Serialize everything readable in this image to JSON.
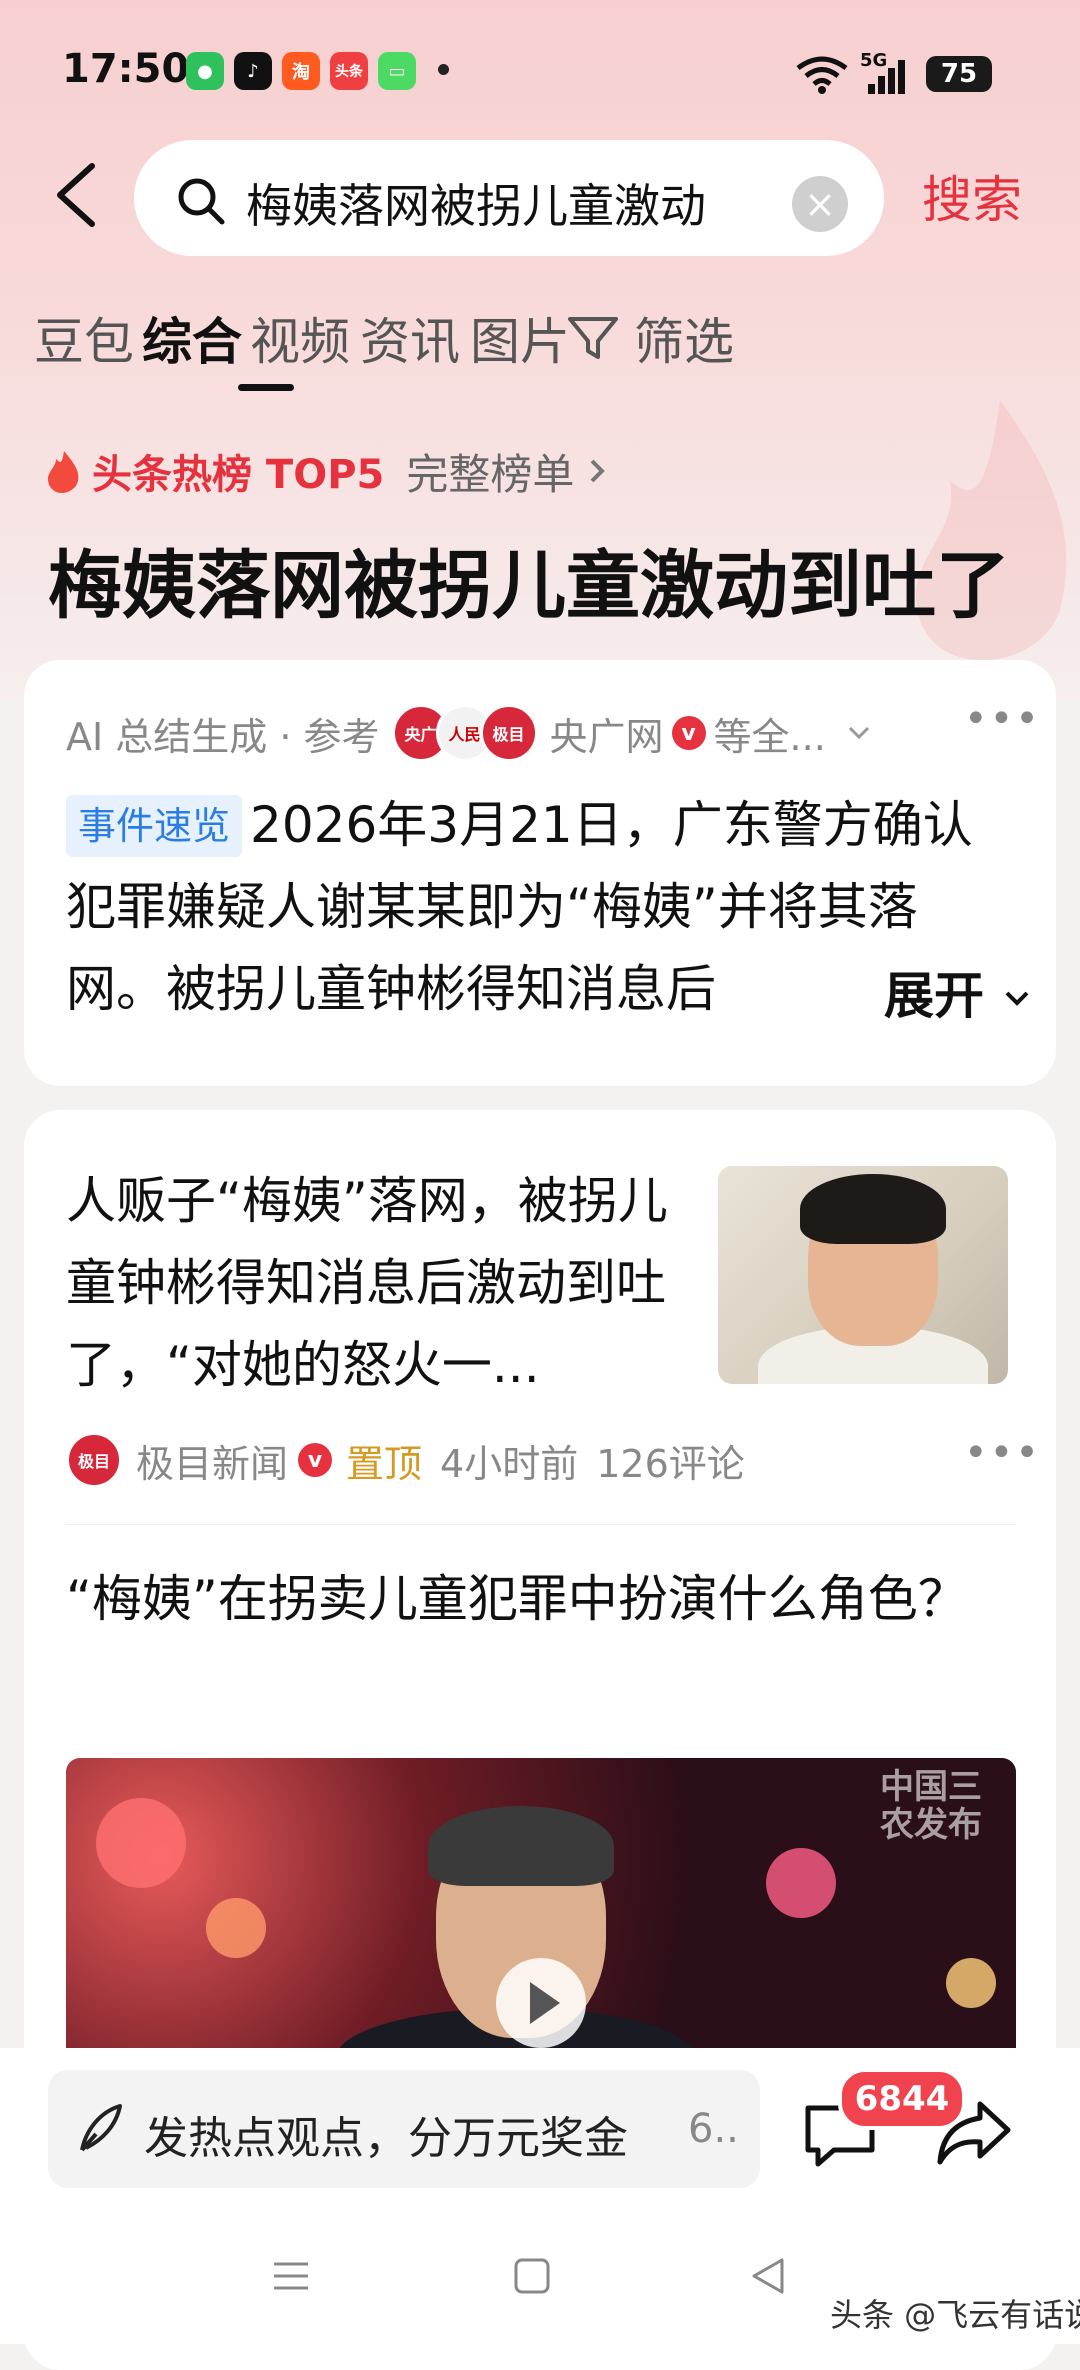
{
  "status_bar": {
    "time": "17:50",
    "network": "5G",
    "battery": "75",
    "apps": [
      {
        "name": "wechat-icon",
        "color": "#2fc15b"
      },
      {
        "name": "douyin-icon",
        "color": "#111111"
      },
      {
        "name": "taobao-icon",
        "color": "#ff5a1f",
        "label": "淘"
      },
      {
        "name": "toutiao-icon",
        "color": "#ef3f41",
        "label": "头条"
      },
      {
        "name": "message-icon",
        "color": "#4cd964"
      }
    ]
  },
  "search": {
    "query": "梅姨落网被拐儿童激动",
    "button": "搜索"
  },
  "tabs": [
    "豆包",
    "综合",
    "视频",
    "资讯",
    "图片"
  ],
  "filter_label": "筛选",
  "hotlist": {
    "label": "头条热榜 TOP5",
    "full_list": "完整榜单",
    "headline": "梅姨落网被拐儿童激动到吐了"
  },
  "ai_summary": {
    "label": "AI 总结生成 · 参考",
    "sources": [
      {
        "name": "央广网",
        "color": "#d6283a"
      },
      {
        "name": "人民日报",
        "color": "#f2f2f2"
      },
      {
        "name": "极目",
        "color": "#d6283a"
      }
    ],
    "source_name": "央广网",
    "source_more": "等全...",
    "event_tag": "事件速览",
    "summary": "2026年3月21日，广东警方确认犯罪嫌疑人谢某某即为“梅姨”并将其落网。被拐儿童钟彬得知消息后",
    "expand": "展开"
  },
  "news": [
    {
      "title": "人贩子“梅姨”落网，被拐儿童钟彬得知消息后激动到吐了，“对她的怒火一...",
      "source": "极目新闻",
      "pinned": "置顶",
      "time": "4小时前",
      "comments": "126评论"
    },
    {
      "title": "“梅姨”在拐卖儿童犯罪中扮演什么角色？",
      "video_watermark": "中国三农发布"
    }
  ],
  "bottom_bar": {
    "placeholder": "发热点观点，分万元奖金",
    "placeholder_more": "6..",
    "comment_count": "6844"
  },
  "watermark": "头条 @飞云有话说"
}
